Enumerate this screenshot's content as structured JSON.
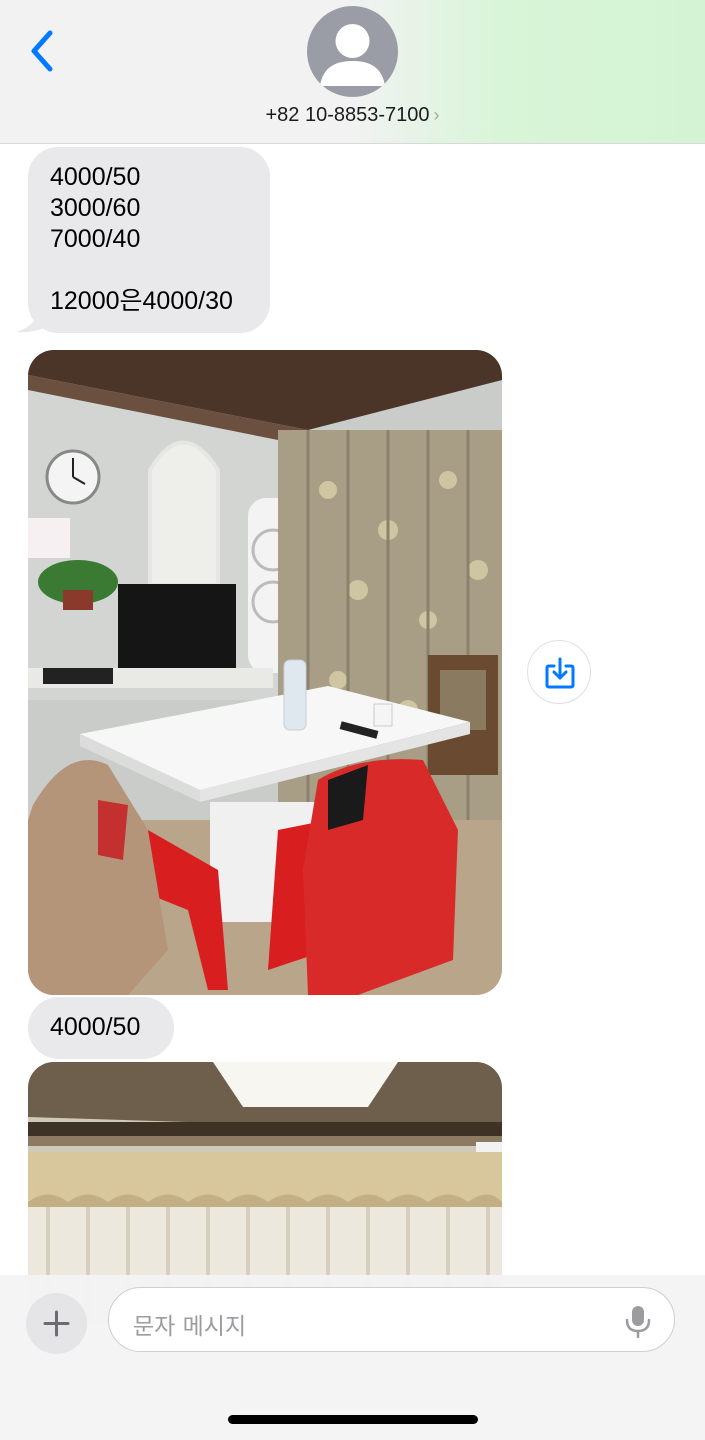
{
  "contact": {
    "phone": "+82 10-8853-7100",
    "chevron": "›"
  },
  "messages": [
    {
      "kind": "text",
      "lines": [
        "4000/50",
        "3000/60",
        "7000/40",
        "",
        "12000은4000/30"
      ]
    },
    {
      "kind": "photo",
      "subject": "room-with-white-table-photo",
      "action_icon": "save-download-icon"
    },
    {
      "kind": "text",
      "text": "4000/50"
    },
    {
      "kind": "photo",
      "subject": "room-with-curtains-photo"
    }
  ],
  "compose": {
    "placeholder": "문자 메시지",
    "left_icon": "plus-icon",
    "right_icon": "microphone-icon"
  },
  "colors": {
    "accent": "#007aff",
    "bubble_gray": "#e9e9eb",
    "header_green": "#d4f3d4"
  }
}
